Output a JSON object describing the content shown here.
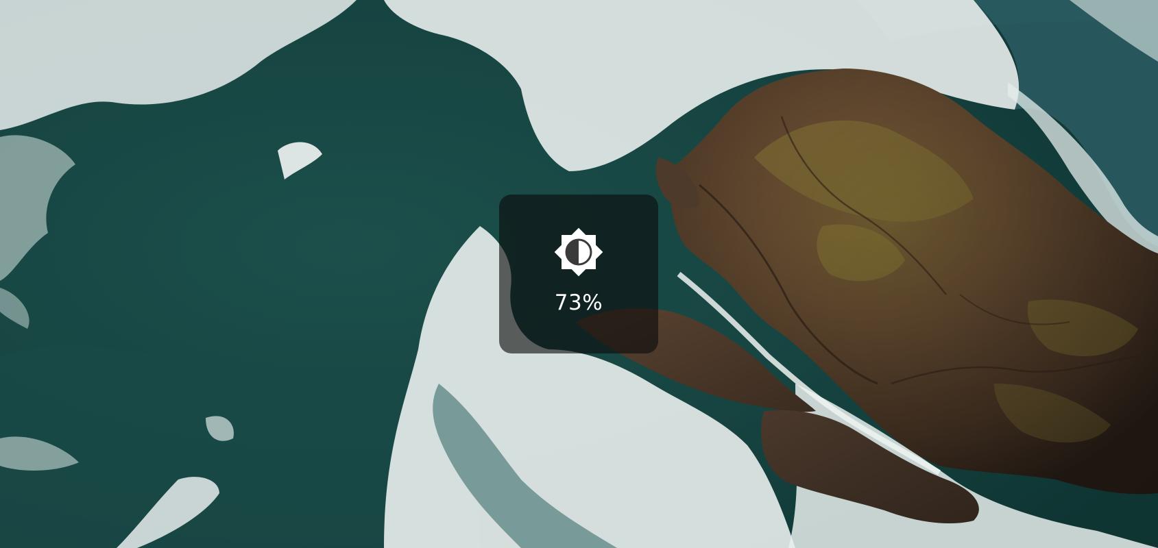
{
  "wallpaper": {
    "icon": "aerial-ocean-rock-wallpaper",
    "colors": {
      "sea_deep": "#123a38",
      "sea_mid": "#1f5651",
      "foam": "#f2f5f3",
      "rock_dark": "#3a2a1f",
      "rock_mid": "#6b5034",
      "moss": "#8d7a35"
    }
  },
  "brightness_osd": {
    "icon": "brightness-icon",
    "value_label": "73%",
    "level": 0.73,
    "background": "rgba(12,12,12,0.62)",
    "text_color": "#ffffff"
  }
}
